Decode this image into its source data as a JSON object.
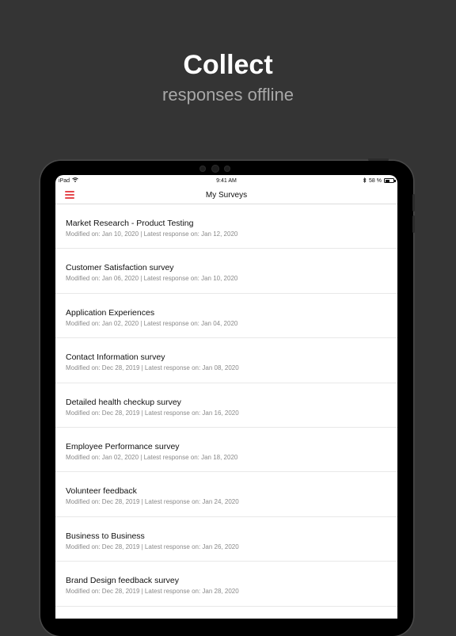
{
  "hero": {
    "title": "Collect",
    "subtitle": "responses offline"
  },
  "status_bar": {
    "device": "iPad",
    "time": "9:41 AM",
    "battery": "58 %",
    "battery_level": 0.58
  },
  "nav": {
    "title": "My Surveys"
  },
  "surveys": [
    {
      "name": "Market Research - Product Testing",
      "meta": "Modified on: Jan 10, 2020 | Latest response on: Jan 12, 2020"
    },
    {
      "name": "Customer Satisfaction survey",
      "meta": "Modified on: Jan 06, 2020 | Latest response on: Jan 10, 2020"
    },
    {
      "name": "Application Experiences",
      "meta": "Modified on: Jan 02, 2020 | Latest response on: Jan 04, 2020"
    },
    {
      "name": "Contact Information survey",
      "meta": "Modified on: Dec 28, 2019 | Latest response on: Jan 08, 2020"
    },
    {
      "name": "Detailed health checkup survey",
      "meta": "Modified on: Dec 28, 2019 | Latest response on: Jan 16, 2020"
    },
    {
      "name": "Employee Performance survey",
      "meta": "Modified on: Jan 02, 2020 | Latest response on: Jan 18, 2020"
    },
    {
      "name": "Volunteer feedback",
      "meta": "Modified on: Dec 28, 2019 | Latest response on: Jan 24, 2020"
    },
    {
      "name": "Business to Business",
      "meta": "Modified on: Dec 28, 2019 | Latest response on: Jan 26, 2020"
    },
    {
      "name": "Brand Design feedback survey",
      "meta": "Modified on: Dec 28, 2019 | Latest response on: Jan 28, 2020"
    }
  ],
  "colors": {
    "background": "#343434",
    "accent": "#e5484d"
  }
}
